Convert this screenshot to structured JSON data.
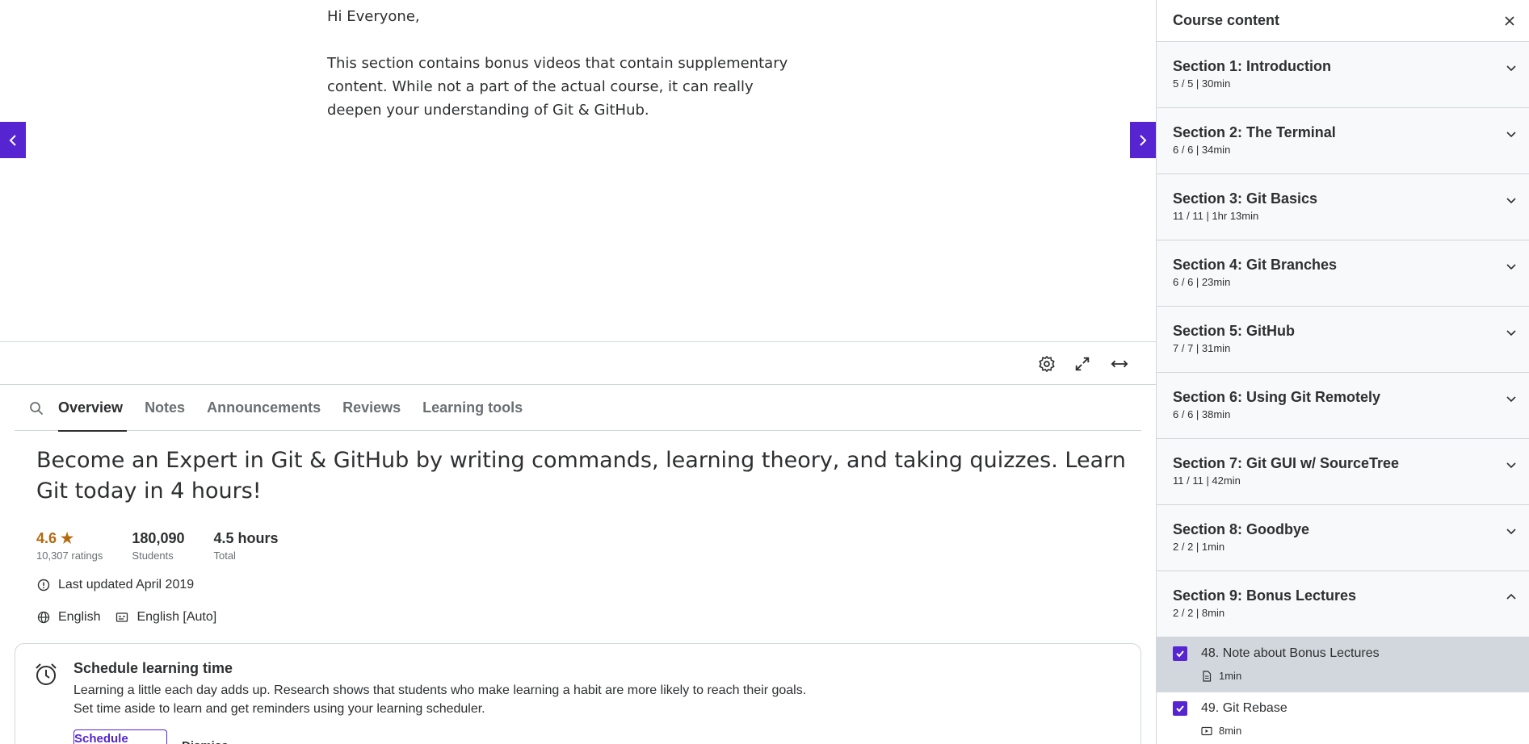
{
  "lecture": {
    "greeting": "Hi Everyone,",
    "body": "This section contains bonus videos that contain supplementary content. While not a part of the actual course, it can really deepen your understanding of Git & GitHub."
  },
  "tabs": [
    {
      "label": "Overview",
      "active": true
    },
    {
      "label": "Notes",
      "active": false
    },
    {
      "label": "Announcements",
      "active": false
    },
    {
      "label": "Reviews",
      "active": false
    },
    {
      "label": "Learning tools",
      "active": false
    }
  ],
  "overview": {
    "title": "Become an Expert in Git & GitHub by writing commands, learning theory, and taking quizzes. Learn Git today in 4 hours!",
    "rating": "4.6",
    "ratings_count": "10,307 ratings",
    "students": "180,090",
    "students_label": "Students",
    "hours": "4.5 hours",
    "hours_label": "Total",
    "last_updated": "Last updated April 2019",
    "language": "English",
    "captions": "English [Auto]"
  },
  "schedule": {
    "title": "Schedule learning time",
    "desc_line1": "Learning a little each day adds up. Research shows that students who make learning a habit are more likely to reach their goals.",
    "desc_line2": "Set time aside to learn and get reminders using your learning scheduler.",
    "button": "Schedule learning time",
    "dismiss": "Dismiss"
  },
  "sidebar": {
    "title": "Course content",
    "sections": [
      {
        "title": "Section 1: Introduction",
        "meta": "5 / 5 | 30min",
        "expanded": false
      },
      {
        "title": "Section 2: The Terminal",
        "meta": "6 / 6 | 34min",
        "expanded": false
      },
      {
        "title": "Section 3: Git Basics",
        "meta": "11 / 11 | 1hr 13min",
        "expanded": false
      },
      {
        "title": "Section 4: Git Branches",
        "meta": "6 / 6 | 23min",
        "expanded": false
      },
      {
        "title": "Section 5: GitHub",
        "meta": "7 / 7 | 31min",
        "expanded": false
      },
      {
        "title": "Section 6: Using Git Remotely",
        "meta": "6 / 6 | 38min",
        "expanded": false
      },
      {
        "title": "Section 7: Git GUI w/ SourceTree",
        "meta": "11 / 11 | 42min",
        "expanded": false
      },
      {
        "title": "Section 8: Goodbye",
        "meta": "2 / 2 | 1min",
        "expanded": false
      },
      {
        "title": "Section 9: Bonus Lectures",
        "meta": "2 / 2 | 8min",
        "expanded": true
      }
    ],
    "lectures": [
      {
        "title": "48. Note about Bonus Lectures",
        "duration": "1min",
        "type": "article",
        "current": true,
        "completed": true
      },
      {
        "title": "49. Git Rebase",
        "duration": "8min",
        "type": "video",
        "current": false,
        "completed": true
      }
    ]
  },
  "colors": {
    "accent": "#5624d0",
    "rating": "#b4690e",
    "border": "#d1d7dc",
    "section_bg": "#f7f9fa"
  }
}
